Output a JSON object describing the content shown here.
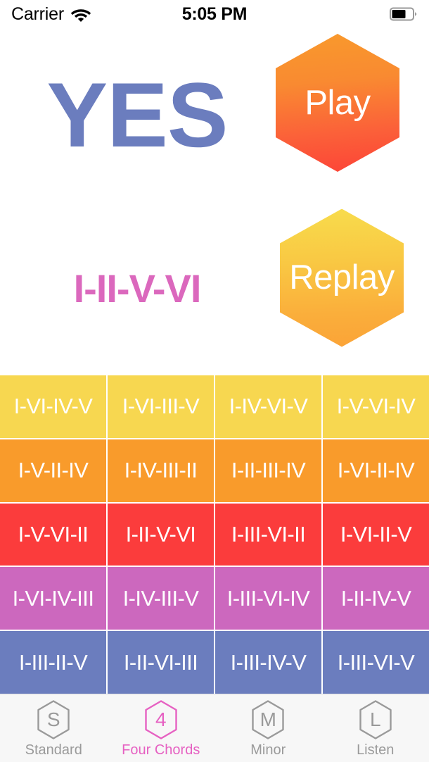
{
  "status_bar": {
    "carrier": "Carrier",
    "wifi_icon": "wifi-icon",
    "time": "5:05 PM",
    "battery_icon": "battery-icon",
    "battery_level_percent": 65
  },
  "game": {
    "answer_text": "YES",
    "answer_color": "#6B7DBE",
    "pattern_text": "I-II-V-VI",
    "pattern_color": "#DB68BD",
    "play_button_label": "Play",
    "replay_button_label": "Replay"
  },
  "chord_grid": {
    "row_colors": [
      "#F7D750",
      "#F99B2B",
      "#FB3C3C",
      "#CC68BE",
      "#6B7DBE"
    ],
    "rows": [
      [
        "I-VI-IV-V",
        "I-VI-III-V",
        "I-IV-VI-V",
        "I-V-VI-IV"
      ],
      [
        "I-V-II-IV",
        "I-IV-III-II",
        "I-II-III-IV",
        "I-VI-II-IV"
      ],
      [
        "I-V-VI-II",
        "I-II-V-VI",
        "I-III-VI-II",
        "I-VI-II-V"
      ],
      [
        "I-VI-IV-III",
        "I-IV-III-V",
        "I-III-VI-IV",
        "I-II-IV-V"
      ],
      [
        "I-III-II-V",
        "I-II-VI-III",
        "I-III-IV-V",
        "I-III-VI-V"
      ]
    ]
  },
  "tab_bar": {
    "active_index": 1,
    "active_color": "#E661C2",
    "inactive_color": "#9A9A9A",
    "items": [
      {
        "glyph": "S",
        "label": "Standard",
        "icon": "hexagon-s-icon"
      },
      {
        "glyph": "4",
        "label": "Four Chords",
        "icon": "hexagon-4-icon"
      },
      {
        "glyph": "M",
        "label": "Minor",
        "icon": "hexagon-m-icon"
      },
      {
        "glyph": "L",
        "label": "Listen",
        "icon": "hexagon-l-icon"
      }
    ]
  }
}
